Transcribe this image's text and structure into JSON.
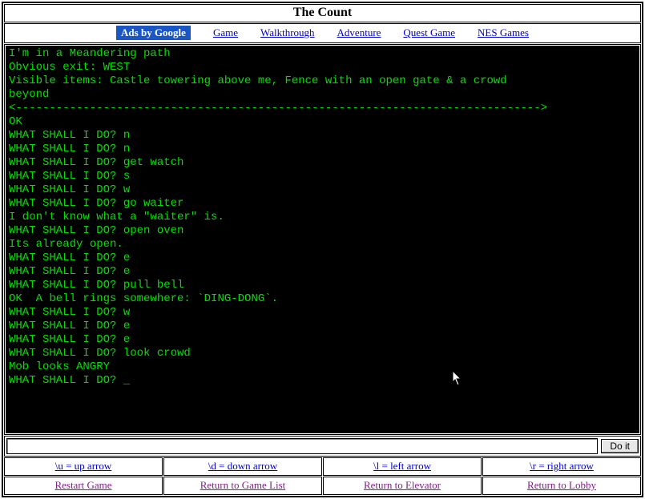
{
  "title": "The Count",
  "nav": {
    "ads": "Ads by Google",
    "items": [
      "Game",
      "Walkthrough",
      "Adventure",
      "Quest Game",
      "NES Games"
    ]
  },
  "terminal": {
    "lines": [
      "I'm in a Meandering path",
      "Obvious exit: WEST",
      "Visible items: Castle towering above me, Fence with an open gate & a crowd",
      "beyond",
      "<------------------------------------------------------------------------------>",
      "OK",
      "WHAT SHALL I DO? n",
      "WHAT SHALL I DO? n",
      "WHAT SHALL I DO? get watch",
      "WHAT SHALL I DO? s",
      "WHAT SHALL I DO? w",
      "WHAT SHALL I DO? go waiter",
      "I don't know what a \"waiter\" is.",
      "WHAT SHALL I DO? open oven",
      "Its already open.",
      "WHAT SHALL I DO? e",
      "WHAT SHALL I DO? e",
      "WHAT SHALL I DO? pull bell",
      "OK  A bell rings somewhere: `DING-DONG`.",
      "WHAT SHALL I DO? w",
      "WHAT SHALL I DO? e",
      "WHAT SHALL I DO? e",
      "WHAT SHALL I DO? look crowd",
      "Mob looks ANGRY",
      "WHAT SHALL I DO? _"
    ]
  },
  "input": {
    "value": "",
    "button": "Do it"
  },
  "hints": {
    "row1": [
      "\\u = up arrow",
      "\\d = down arrow",
      "\\l = left arrow",
      "\\r = right arrow"
    ],
    "row2": [
      "Restart Game",
      "Return to Game List",
      "Return to Elevator",
      "Return to Lobby"
    ]
  }
}
